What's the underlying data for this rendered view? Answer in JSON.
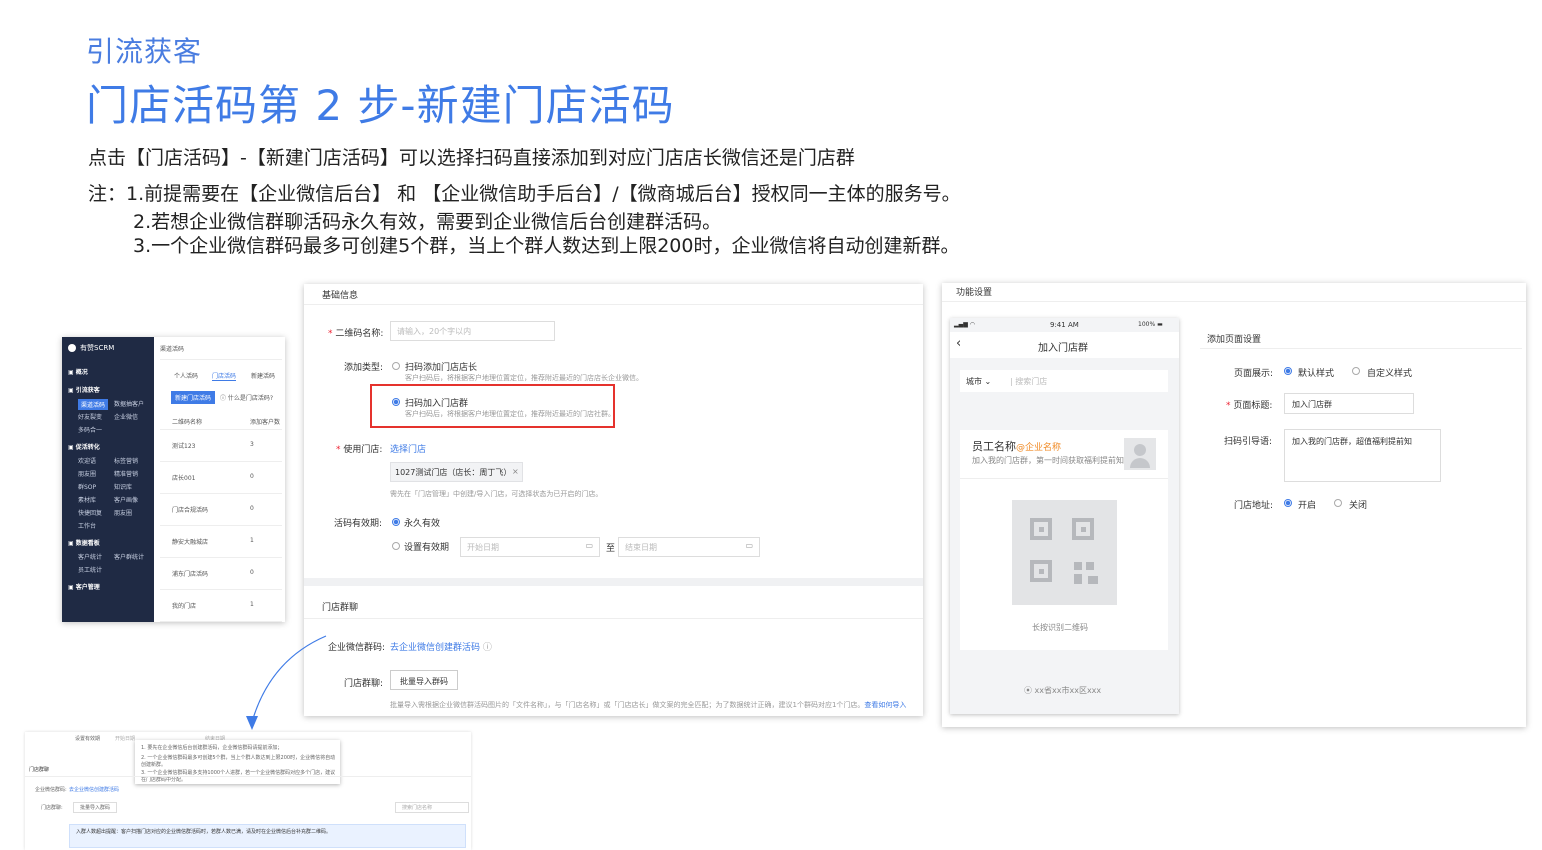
{
  "header": {
    "kicker": "引流获客",
    "title": "门店活码第 2 步-新建门店活码"
  },
  "description": "点击【门店活码】-【新建门店活码】可以选择扫码直接添加到对应门店店长微信还是门店群",
  "notes": [
    "注：1.前提需要在【企业微信后台】 和 【企业微信助手后台】/【微商城后台】授权同一主体的服务号。",
    "2.若想企业微信群聊活码永久有效，需要到企业微信后台创建群活码。",
    "3.一个企业微信群码最多可创建5个群，当上个群人数达到上限200时，企业微信将自动创建新群。"
  ],
  "admin": {
    "brand": "有赞SCRM",
    "page_title": "渠道活码",
    "sidebar": [
      {
        "label": "概况",
        "header": true
      },
      {
        "label": "引流获客",
        "header": true
      },
      {
        "label": "渠道活码",
        "selected": true
      },
      {
        "label": "数据抽客户"
      },
      {
        "label": "好友裂变"
      },
      {
        "label": "企业微信"
      },
      {
        "label": "多码合一"
      },
      {
        "label": "促活转化",
        "header": true
      },
      {
        "label": "欢迎语"
      },
      {
        "label": "标签营销"
      },
      {
        "label": "朋友圈"
      },
      {
        "label": "精准营销"
      },
      {
        "label": "群SOP"
      },
      {
        "label": "知识库"
      },
      {
        "label": "素材库"
      },
      {
        "label": "客户画像"
      },
      {
        "label": "快捷回复"
      },
      {
        "label": "朋友圈"
      },
      {
        "label": "工作台"
      },
      {
        "label": "数据看板",
        "header": true
      },
      {
        "label": "客户统计"
      },
      {
        "label": "客户群统计"
      },
      {
        "label": "员工统计"
      },
      {
        "label": "客户管理",
        "header": true
      }
    ],
    "tabs": [
      "个人活码",
      "门店活码",
      "新建活码"
    ],
    "new_button": "新建门店活码",
    "help_link": "什么是门店活码?",
    "columns": [
      "二维码名称",
      "添加客户数"
    ],
    "rows": [
      {
        "name": "测试123",
        "count": "3"
      },
      {
        "name": "店长001",
        "count": "0"
      },
      {
        "name": "门店合规活码",
        "count": "0"
      },
      {
        "name": "静安大融城店",
        "count": "1"
      },
      {
        "name": "浦东门店活码",
        "count": "0"
      },
      {
        "name": "我的门店",
        "count": "1"
      }
    ]
  },
  "form": {
    "section_basic": "基础信息",
    "name_label": "二维码名称:",
    "name_placeholder": "请输入，20个字以内",
    "type_label": "添加类型:",
    "type_option1": "扫码添加门店店长",
    "type_option1_hint": "客户扫码后，将根据客户地理位置定位，推荐附近最近的门店店长企业微信。",
    "type_option2": "扫码加入门店群",
    "type_option2_hint": "客户扫码后，将根据客户地理位置定位，推荐附近最近的门店社群。",
    "store_label": "使用门店:",
    "store_link": "选择门店",
    "store_tag": "1027测试门店（店长：周丁飞）",
    "store_hint": "需先在「门店管理」中创建/导入门店，可选择状态为已开启的门店。",
    "validity_label": "活码有效期:",
    "validity_option1": "永久有效",
    "validity_option2": "设置有效期",
    "start_date": "开始日期",
    "to": "至",
    "end_date": "结束日期",
    "section_group": "门店群聊",
    "qr_label": "企业微信群码:",
    "qr_link": "去企业微信创建群活码",
    "group_label": "门店群聊:",
    "import_button": "批量导入群码",
    "import_hint": "批量导入需根据企业微信群活码图片的「文件名称」，与「门店名称」或「门店店长」做文案的完全匹配；为了数据统计正确，建议1个群码对应1个门店。",
    "import_link": "查看如何导入"
  },
  "phone": {
    "section": "功能设置",
    "time": "9:41 AM",
    "battery": "100%",
    "title": "加入门店群",
    "city": "城市",
    "search_placeholder": "搜索门店",
    "employee": "员工名称",
    "company": "@企业名称",
    "invite": "加入我的门店群，第一时间获取福利提前知",
    "scan_tip": "长按识别二维码",
    "address": "xx省xx市xx区xxx"
  },
  "settings": {
    "section": "添加页面设置",
    "page_label": "页面展示:",
    "page_opt1": "默认样式",
    "page_opt2": "自定义样式",
    "title_label": "页面标题:",
    "title_value": "加入门店群",
    "guide_label": "扫码引导语:",
    "guide_value": "加入我的门店群，超值福利提前知",
    "addr_label": "门店地址:",
    "addr_opt1": "开启",
    "addr_opt2": "关闭"
  },
  "mini": {
    "validity_label": "设置有效期",
    "start": "开始日期",
    "end": "结束日期",
    "tip_lines": [
      "1. 要先在企业微信后台创建群活码，企业微信群码请提前添加；",
      "2. 一个企业微信群码最多可创建5个群，当上个群人数达到上限200时，企业微信将自动创建新群。",
      "3. 一个企业微信群码最多支持1000个人进群，若一个企业微信群码对应多个门店，建议在门店群码中分配。"
    ],
    "group_label": "门店群聊",
    "qr_label": "企业微信群码:",
    "qr_link": "去企业微信创建群活码",
    "group_field": "门店群聊:",
    "import_btn": "批量导入群码",
    "search_ph": "搜索门店名称",
    "info": "入群人数超出提醒：客户扫描门店对应的企业微信群活码时，若群人数已满，请及时在企业微信后台补充群二维码。"
  }
}
